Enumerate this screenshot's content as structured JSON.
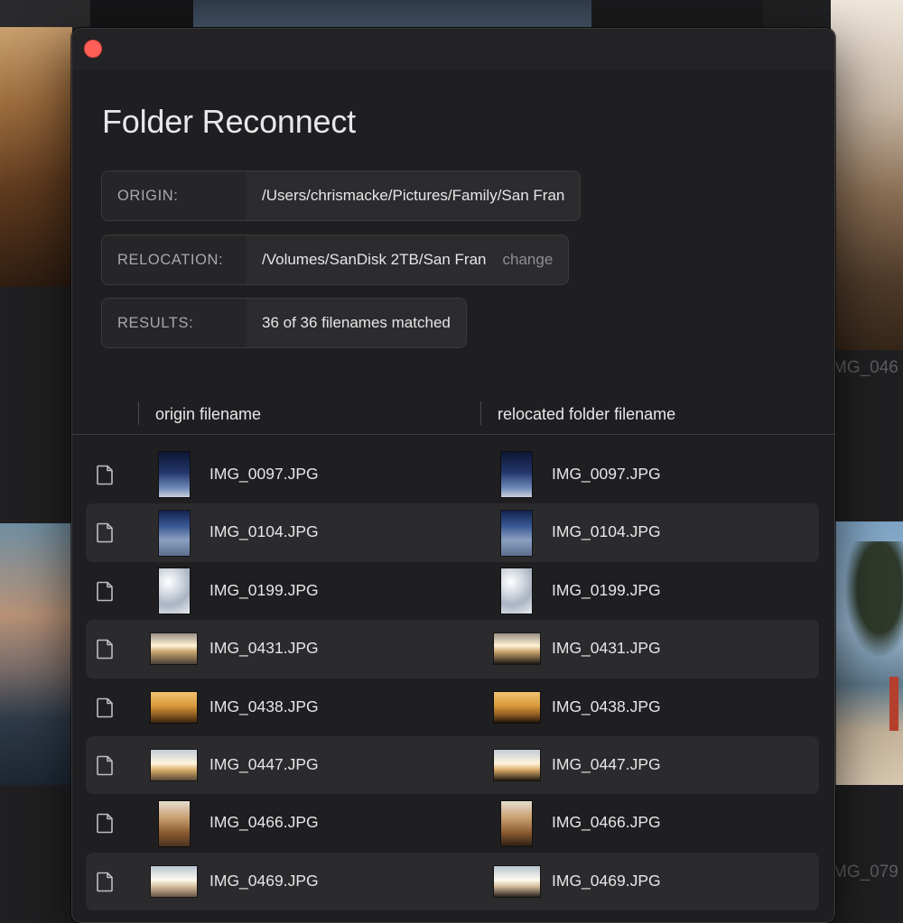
{
  "window": {
    "title": "Folder Reconnect",
    "close_button": "close",
    "accent_close": "#fe5f57"
  },
  "info": {
    "origin": {
      "label": "ORIGIN:",
      "value": "/Users/chrismacke/Pictures/Family/San Fran"
    },
    "relocation": {
      "label": "RELOCATION:",
      "value": "/Volumes/SanDisk 2TB/San Fran",
      "change_label": "change"
    },
    "results": {
      "label": "RESULTS:",
      "value": "36 of 36 filenames matched"
    }
  },
  "table": {
    "columns": {
      "origin": "origin filename",
      "relocated": "relocated folder filename"
    },
    "rows": [
      {
        "origin": "IMG_0097.JPG",
        "relocated": "IMG_0097.JPG",
        "icon": "document-icon"
      },
      {
        "origin": "IMG_0104.JPG",
        "relocated": "IMG_0104.JPG",
        "icon": "document-icon"
      },
      {
        "origin": "IMG_0199.JPG",
        "relocated": "IMG_0199.JPG",
        "icon": "document-icon"
      },
      {
        "origin": "IMG_0431.JPG",
        "relocated": "IMG_0431.JPG",
        "icon": "document-icon"
      },
      {
        "origin": "IMG_0438.JPG",
        "relocated": "IMG_0438.JPG",
        "icon": "document-icon"
      },
      {
        "origin": "IMG_0447.JPG",
        "relocated": "IMG_0447.JPG",
        "icon": "document-icon"
      },
      {
        "origin": "IMG_0466.JPG",
        "relocated": "IMG_0466.JPG",
        "icon": "document-icon"
      },
      {
        "origin": "IMG_0469.JPG",
        "relocated": "IMG_0469.JPG",
        "icon": "document-icon"
      }
    ]
  },
  "background": {
    "labels": [
      "MG_046",
      "MG_079"
    ]
  }
}
